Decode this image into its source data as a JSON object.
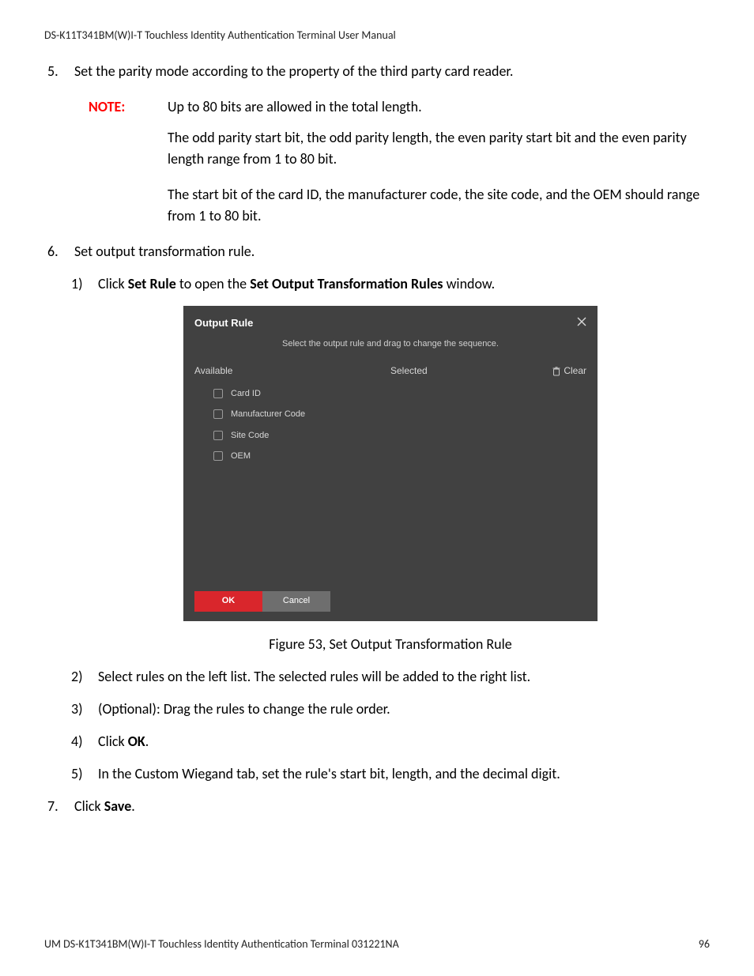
{
  "header": "DS-K11T341BM(W)I-T Touchless Identity Authentication Terminal User Manual",
  "step5": {
    "num": "5.",
    "text": "Set the parity mode according to the property of the third party card reader.",
    "note_label": "NOTE:",
    "note_line1": "Up to 80 bits are allowed in the total length.",
    "note_line2": "The odd parity start bit, the odd parity length, the even parity start bit and the even parity length range from 1 to 80 bit.",
    "note_line3": "The start bit of the card ID, the manufacturer code, the site code, and the OEM should range from 1 to 80 bit."
  },
  "step6": {
    "num": "6.",
    "text": "Set output transformation rule.",
    "sub1": {
      "num": "1)",
      "pre": "Click ",
      "b1": "Set Rule",
      "mid": " to open the ",
      "b2": "Set Output Transformation Rules",
      "post": " window."
    }
  },
  "dialog": {
    "title": "Output Rule",
    "subtitle": "Select the output rule and drag to change the sequence.",
    "available_label": "Available",
    "selected_label": "Selected",
    "clear_label": "Clear",
    "items": [
      "Card ID",
      "Manufacturer Code",
      "Site Code",
      "OEM"
    ],
    "ok": "OK",
    "cancel": "Cancel"
  },
  "figure_caption": "Figure 53, Set Output Transformation Rule",
  "sub2": {
    "num": "2)",
    "text": "Select rules on the left list. The selected rules will be added to the right list."
  },
  "sub3": {
    "num": "3)",
    "text": "(Optional): Drag the rules to change the rule order."
  },
  "sub4": {
    "num": "4)",
    "pre": "Click ",
    "b": "OK",
    "post": "."
  },
  "sub5": {
    "num": "5)",
    "text": "In the Custom Wiegand tab, set the rule's start bit, length, and the decimal digit."
  },
  "step7": {
    "num": "7.",
    "pre": "Click ",
    "b": "Save",
    "post": "."
  },
  "footer_left": "UM DS-K1T341BM(W)I-T Touchless Identity Authentication Terminal 031221NA",
  "footer_right": "96"
}
